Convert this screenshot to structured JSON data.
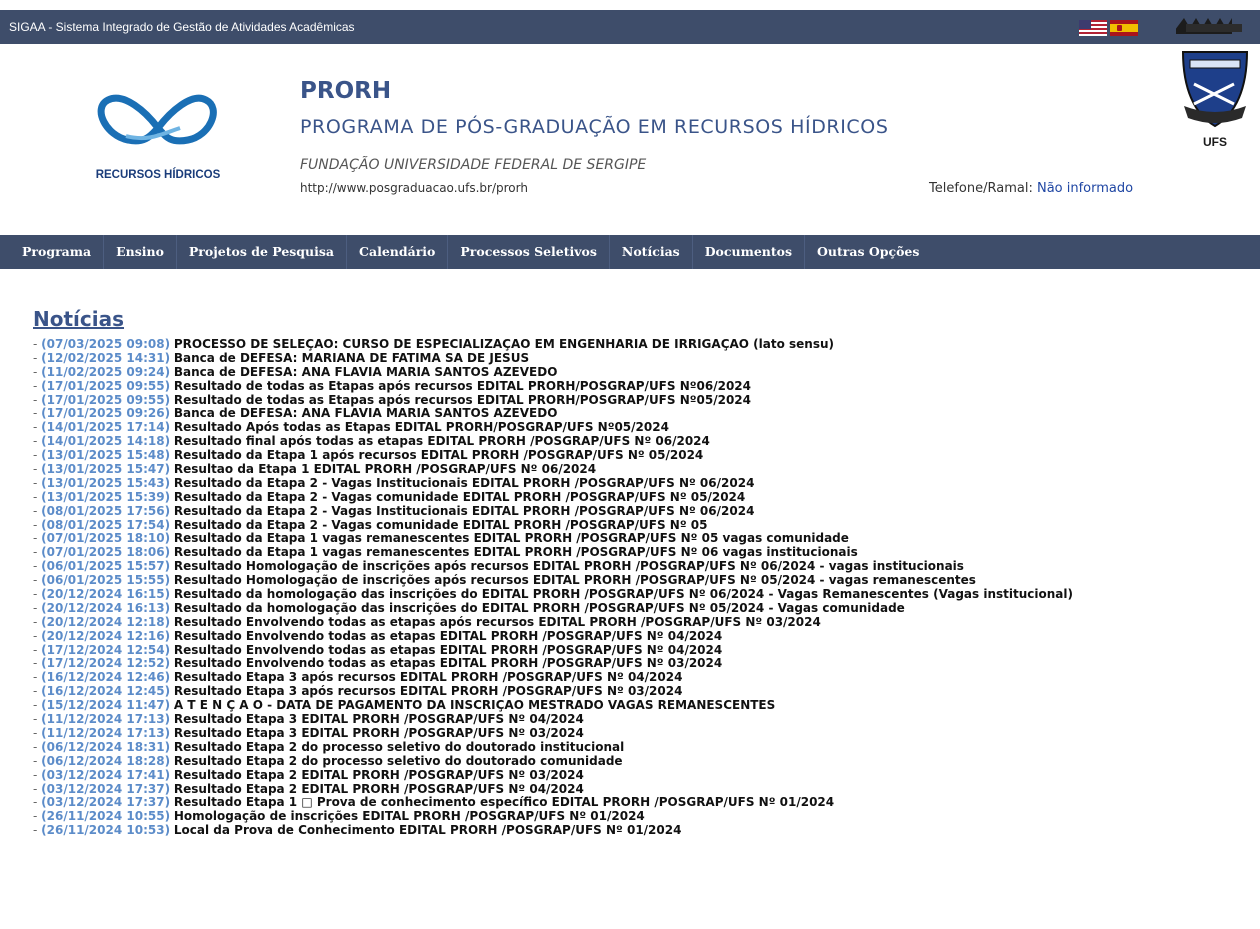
{
  "topbar": {
    "title": "SIGAA - Sistema Integrado de Gestão de Atividades Acadêmicas"
  },
  "icons": {
    "flag_en": "us-flag-icon",
    "flag_es": "spain-flag-icon",
    "crest": "ufs-crest-icon",
    "logo": "recursos-hidricos-logo"
  },
  "logo": {
    "text": "RECURSOS HÍDRICOS"
  },
  "program": {
    "abbr": "PRORH",
    "name": "PROGRAMA DE PÓS-GRADUAÇÃO EM RECURSOS HÍDRICOS",
    "institution": "FUNDAÇÃO UNIVERSIDADE FEDERAL DE SERGIPE",
    "website": "http://www.posgraduacao.ufs.br/prorh",
    "phone_label": "Telefone/Ramal:",
    "phone_value": "Não informado"
  },
  "nav": [
    {
      "label": "Programa"
    },
    {
      "label": "Ensino"
    },
    {
      "label": "Projetos de Pesquisa"
    },
    {
      "label": "Calendário"
    },
    {
      "label": "Processos Seletivos"
    },
    {
      "label": "Notícias"
    },
    {
      "label": "Documentos"
    },
    {
      "label": "Outras Opções"
    }
  ],
  "news": {
    "heading": "Notícias",
    "items": [
      {
        "date": "(07/03/2025 09:08)",
        "title": "PROCESSO DE SELEÇÃO: CURSO DE ESPECIALIZAÇÃO EM ENGENHARIA DE IRRIGAÇÃO (lato sensu)"
      },
      {
        "date": "(12/02/2025 14:31)",
        "title": "Banca de DEFESA: MARIANA DE FÁTIMA SÁ DE JESUS"
      },
      {
        "date": "(11/02/2025 09:24)",
        "title": "Banca de DEFESA: ANA FLAVIA MARIA SANTOS AZEVEDO"
      },
      {
        "date": "(17/01/2025 09:55)",
        "title": "Resultado de todas as Etapas após recursos EDITAL PRORH/POSGRAP/UFS Nº06/2024"
      },
      {
        "date": "(17/01/2025 09:55)",
        "title": "Resultado de todas as Etapas após recursos EDITAL PRORH/POSGRAP/UFS Nº05/2024"
      },
      {
        "date": "(17/01/2025 09:26)",
        "title": "Banca de DEFESA: ANA FLAVIA MARIA SANTOS AZEVEDO"
      },
      {
        "date": "(14/01/2025 17:14)",
        "title": "Resultado Após todas as Etapas EDITAL PRORH/POSGRAP/UFS Nº05/2024"
      },
      {
        "date": "(14/01/2025 14:18)",
        "title": "Resultado final após todas as etapas EDITAL PRORH /POSGRAP/UFS Nº 06/2024"
      },
      {
        "date": "(13/01/2025 15:48)",
        "title": "Resultado da Etapa 1 após recursos EDITAL PRORH /POSGRAP/UFS Nº 05/2024"
      },
      {
        "date": "(13/01/2025 15:47)",
        "title": "Resultao da Etapa 1 EDITAL PRORH /POSGRAP/UFS Nº 06/2024"
      },
      {
        "date": "(13/01/2025 15:43)",
        "title": "Resultado da Etapa 2 - Vagas Institucionais EDITAL PRORH /POSGRAP/UFS Nº 06/2024"
      },
      {
        "date": "(13/01/2025 15:39)",
        "title": "Resultado da Etapa 2 - Vagas comunidade EDITAL PRORH /POSGRAP/UFS Nº 05/2024"
      },
      {
        "date": "(08/01/2025 17:56)",
        "title": "Resultado da Etapa 2 - Vagas Institucionais EDITAL PRORH /POSGRAP/UFS Nº 06/2024"
      },
      {
        "date": "(08/01/2025 17:54)",
        "title": "Resultado da Etapa 2 - Vagas comunidade EDITAL PRORH /POSGRAP/UFS Nº 05"
      },
      {
        "date": "(07/01/2025 18:10)",
        "title": "Resultado da Etapa 1 vagas remanescentes EDITAL PRORH /POSGRAP/UFS Nº 05 vagas comunidade"
      },
      {
        "date": "(07/01/2025 18:06)",
        "title": "Resultado da Etapa 1 vagas remanescentes EDITAL PRORH /POSGRAP/UFS Nº 06 vagas institucionais"
      },
      {
        "date": "(06/01/2025 15:57)",
        "title": "Resultado Homologação de inscrições após recursos EDITAL PRORH /POSGRAP/UFS Nº 06/2024 - vagas institucionais"
      },
      {
        "date": "(06/01/2025 15:55)",
        "title": "Resultado Homologação de inscrições após recursos EDITAL PRORH /POSGRAP/UFS Nº 05/2024 - vagas remanescentes"
      },
      {
        "date": "(20/12/2024 16:15)",
        "title": "Resultado da homologação das inscrições do EDITAL PRORH /POSGRAP/UFS Nº 06/2024 - Vagas Remanescentes (Vagas institucional)"
      },
      {
        "date": "(20/12/2024 16:13)",
        "title": "Resultado da homologação das inscrições do EDITAL PRORH /POSGRAP/UFS Nº 05/2024 - Vagas comunidade"
      },
      {
        "date": "(20/12/2024 12:18)",
        "title": "Resultado Envolvendo todas as etapas após recursos EDITAL PRORH /POSGRAP/UFS Nº 03/2024"
      },
      {
        "date": "(20/12/2024 12:16)",
        "title": "Resultado Envolvendo todas as etapas EDITAL PRORH /POSGRAP/UFS Nº 04/2024"
      },
      {
        "date": "(17/12/2024 12:54)",
        "title": "Resultado Envolvendo todas as etapas EDITAL PRORH /POSGRAP/UFS Nº 04/2024"
      },
      {
        "date": "(17/12/2024 12:52)",
        "title": "Resultado Envolvendo todas as etapas EDITAL PRORH /POSGRAP/UFS Nº 03/2024"
      },
      {
        "date": "(16/12/2024 12:46)",
        "title": "Resultado Etapa 3 após recursos EDITAL PRORH /POSGRAP/UFS Nº 04/2024"
      },
      {
        "date": "(16/12/2024 12:45)",
        "title": "Resultado Etapa 3 após recursos EDITAL PRORH /POSGRAP/UFS Nº 03/2024"
      },
      {
        "date": "(15/12/2024 11:47)",
        "title": "A T E N Ç Ã O - DATA DE PAGAMENTO DA INSCRIÇÃO MESTRADO VAGAS REMANESCENTES"
      },
      {
        "date": "(11/12/2024 17:13)",
        "title": "Resultado Etapa 3 EDITAL PRORH /POSGRAP/UFS Nº 04/2024"
      },
      {
        "date": "(11/12/2024 17:13)",
        "title": "Resultado Etapa 3 EDITAL PRORH /POSGRAP/UFS Nº 03/2024"
      },
      {
        "date": "(06/12/2024 18:31)",
        "title": "Resultado Etapa 2 do processo seletivo do doutorado institucional"
      },
      {
        "date": "(06/12/2024 18:28)",
        "title": "Resultado Etapa 2 do processo seletivo do doutorado comunidade"
      },
      {
        "date": "(03/12/2024 17:41)",
        "title": "Resultado Etapa 2 EDITAL PRORH /POSGRAP/UFS Nº 03/2024"
      },
      {
        "date": "(03/12/2024 17:37)",
        "title": "Resultado Etapa 2 EDITAL PRORH /POSGRAP/UFS Nº 04/2024"
      },
      {
        "date": "(03/12/2024 17:37)",
        "title": "Resultado Etapa 1 □ Prova de conhecimento específico EDITAL PRORH /POSGRAP/UFS Nº 01/2024"
      },
      {
        "date": "(26/11/2024 10:55)",
        "title": "Homologação de inscrições EDITAL PRORH /POSGRAP/UFS Nº 01/2024"
      },
      {
        "date": "(26/11/2024 10:53)",
        "title": "Local da Prova de Conhecimento EDITAL PRORH /POSGRAP/UFS Nº 01/2024"
      }
    ]
  }
}
